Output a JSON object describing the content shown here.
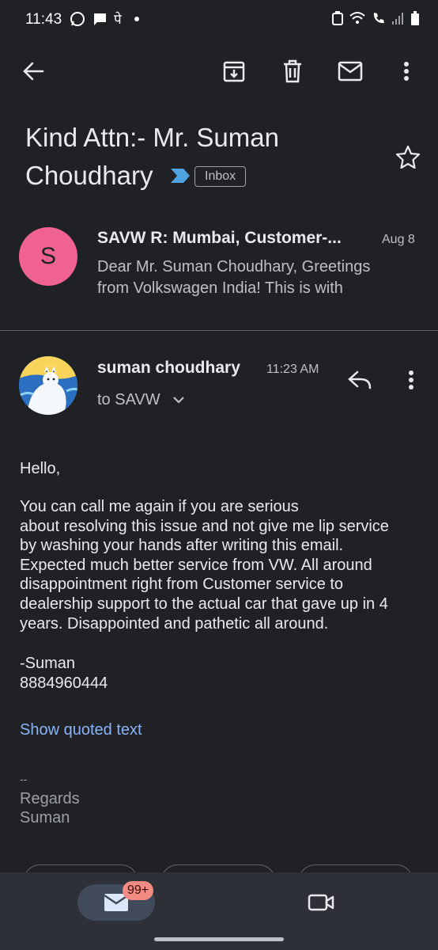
{
  "status_bar": {
    "time": "11:43",
    "letter_glyph": "पे"
  },
  "subject": {
    "line1": "Kind Attn:- Mr. Suman",
    "line2": "Choudhary",
    "label_badge": "Inbox"
  },
  "collapsed_message": {
    "avatar_letter": "S",
    "title": "SAVW R: Mumbai, Customer-...",
    "date": "Aug 8",
    "snippet_line1": "Dear Mr. Suman Choudhary, Greetings",
    "snippet_line2": "from Volkswagen India! This is with"
  },
  "expanded_message": {
    "sender": "suman choudhary",
    "time": "11:23 AM",
    "recipient": "to SAVW",
    "body": {
      "greeting": "Hello,",
      "para_lines": [
        "You can call me again if you are serious",
        "about resolving this issue and not give me lip service",
        "by washing your hands after writing this email.",
        "Expected much better service from VW. All around",
        "disappointment right from Customer service to",
        "dealership support to the actual car that gave up in 4",
        "years. Disappointed and pathetic all around."
      ],
      "signoff_name": "-Suman",
      "signoff_phone": "8884960444"
    },
    "show_quoted": "Show quoted text",
    "signature": {
      "dash": "--",
      "regards": "Regards",
      "name": "Suman"
    }
  },
  "bottom_nav": {
    "mail_badge": "99+"
  },
  "colors": {
    "background": "#202124",
    "link": "#8ab4f8",
    "avatar_s": "#f06292",
    "badge": "#f28b82"
  }
}
